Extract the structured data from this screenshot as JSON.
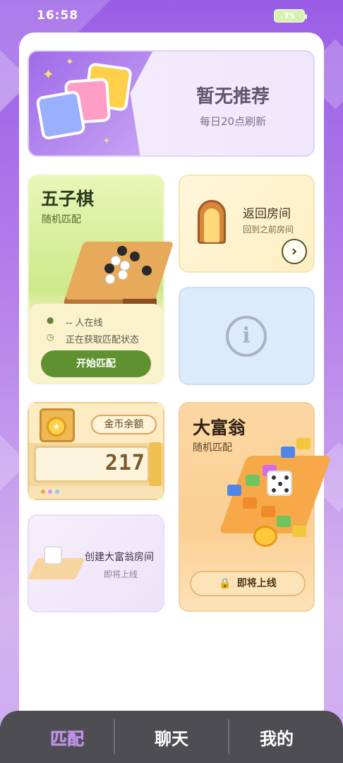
{
  "status_bar": {
    "time": "16:58",
    "battery": "75"
  },
  "recommend": {
    "title": "暂无推荐",
    "subtitle": "每日20点刷新"
  },
  "gomoku": {
    "title": "五子棋",
    "subtitle": "随机匹配",
    "online": "-- 人在线",
    "status": "正在获取匹配状态",
    "start_label": "开始匹配"
  },
  "return_room": {
    "title": "返回房间",
    "subtitle": "回到之前房间",
    "chevron": "›"
  },
  "info_card": {
    "glyph": "i"
  },
  "coins": {
    "label": "金币余额",
    "value": "217"
  },
  "create_room": {
    "title": "创建大富翁房间",
    "subtitle": "即将上线"
  },
  "monopoly": {
    "title": "大富翁",
    "subtitle": "随机匹配",
    "soon_label": "即将上线"
  },
  "tabs": [
    {
      "label": "匹配",
      "active": true
    },
    {
      "label": "聊天",
      "active": false
    },
    {
      "label": "我的",
      "active": false
    }
  ],
  "colors": {
    "accent_purple": "#c08ef0",
    "gomoku_green": "#5f9130",
    "tabbar": "#4e4d51"
  },
  "icons": [
    "battery-icon",
    "users-icon",
    "clock-icon",
    "chevron-right-icon",
    "info-icon",
    "coin-icon",
    "lock-icon"
  ]
}
